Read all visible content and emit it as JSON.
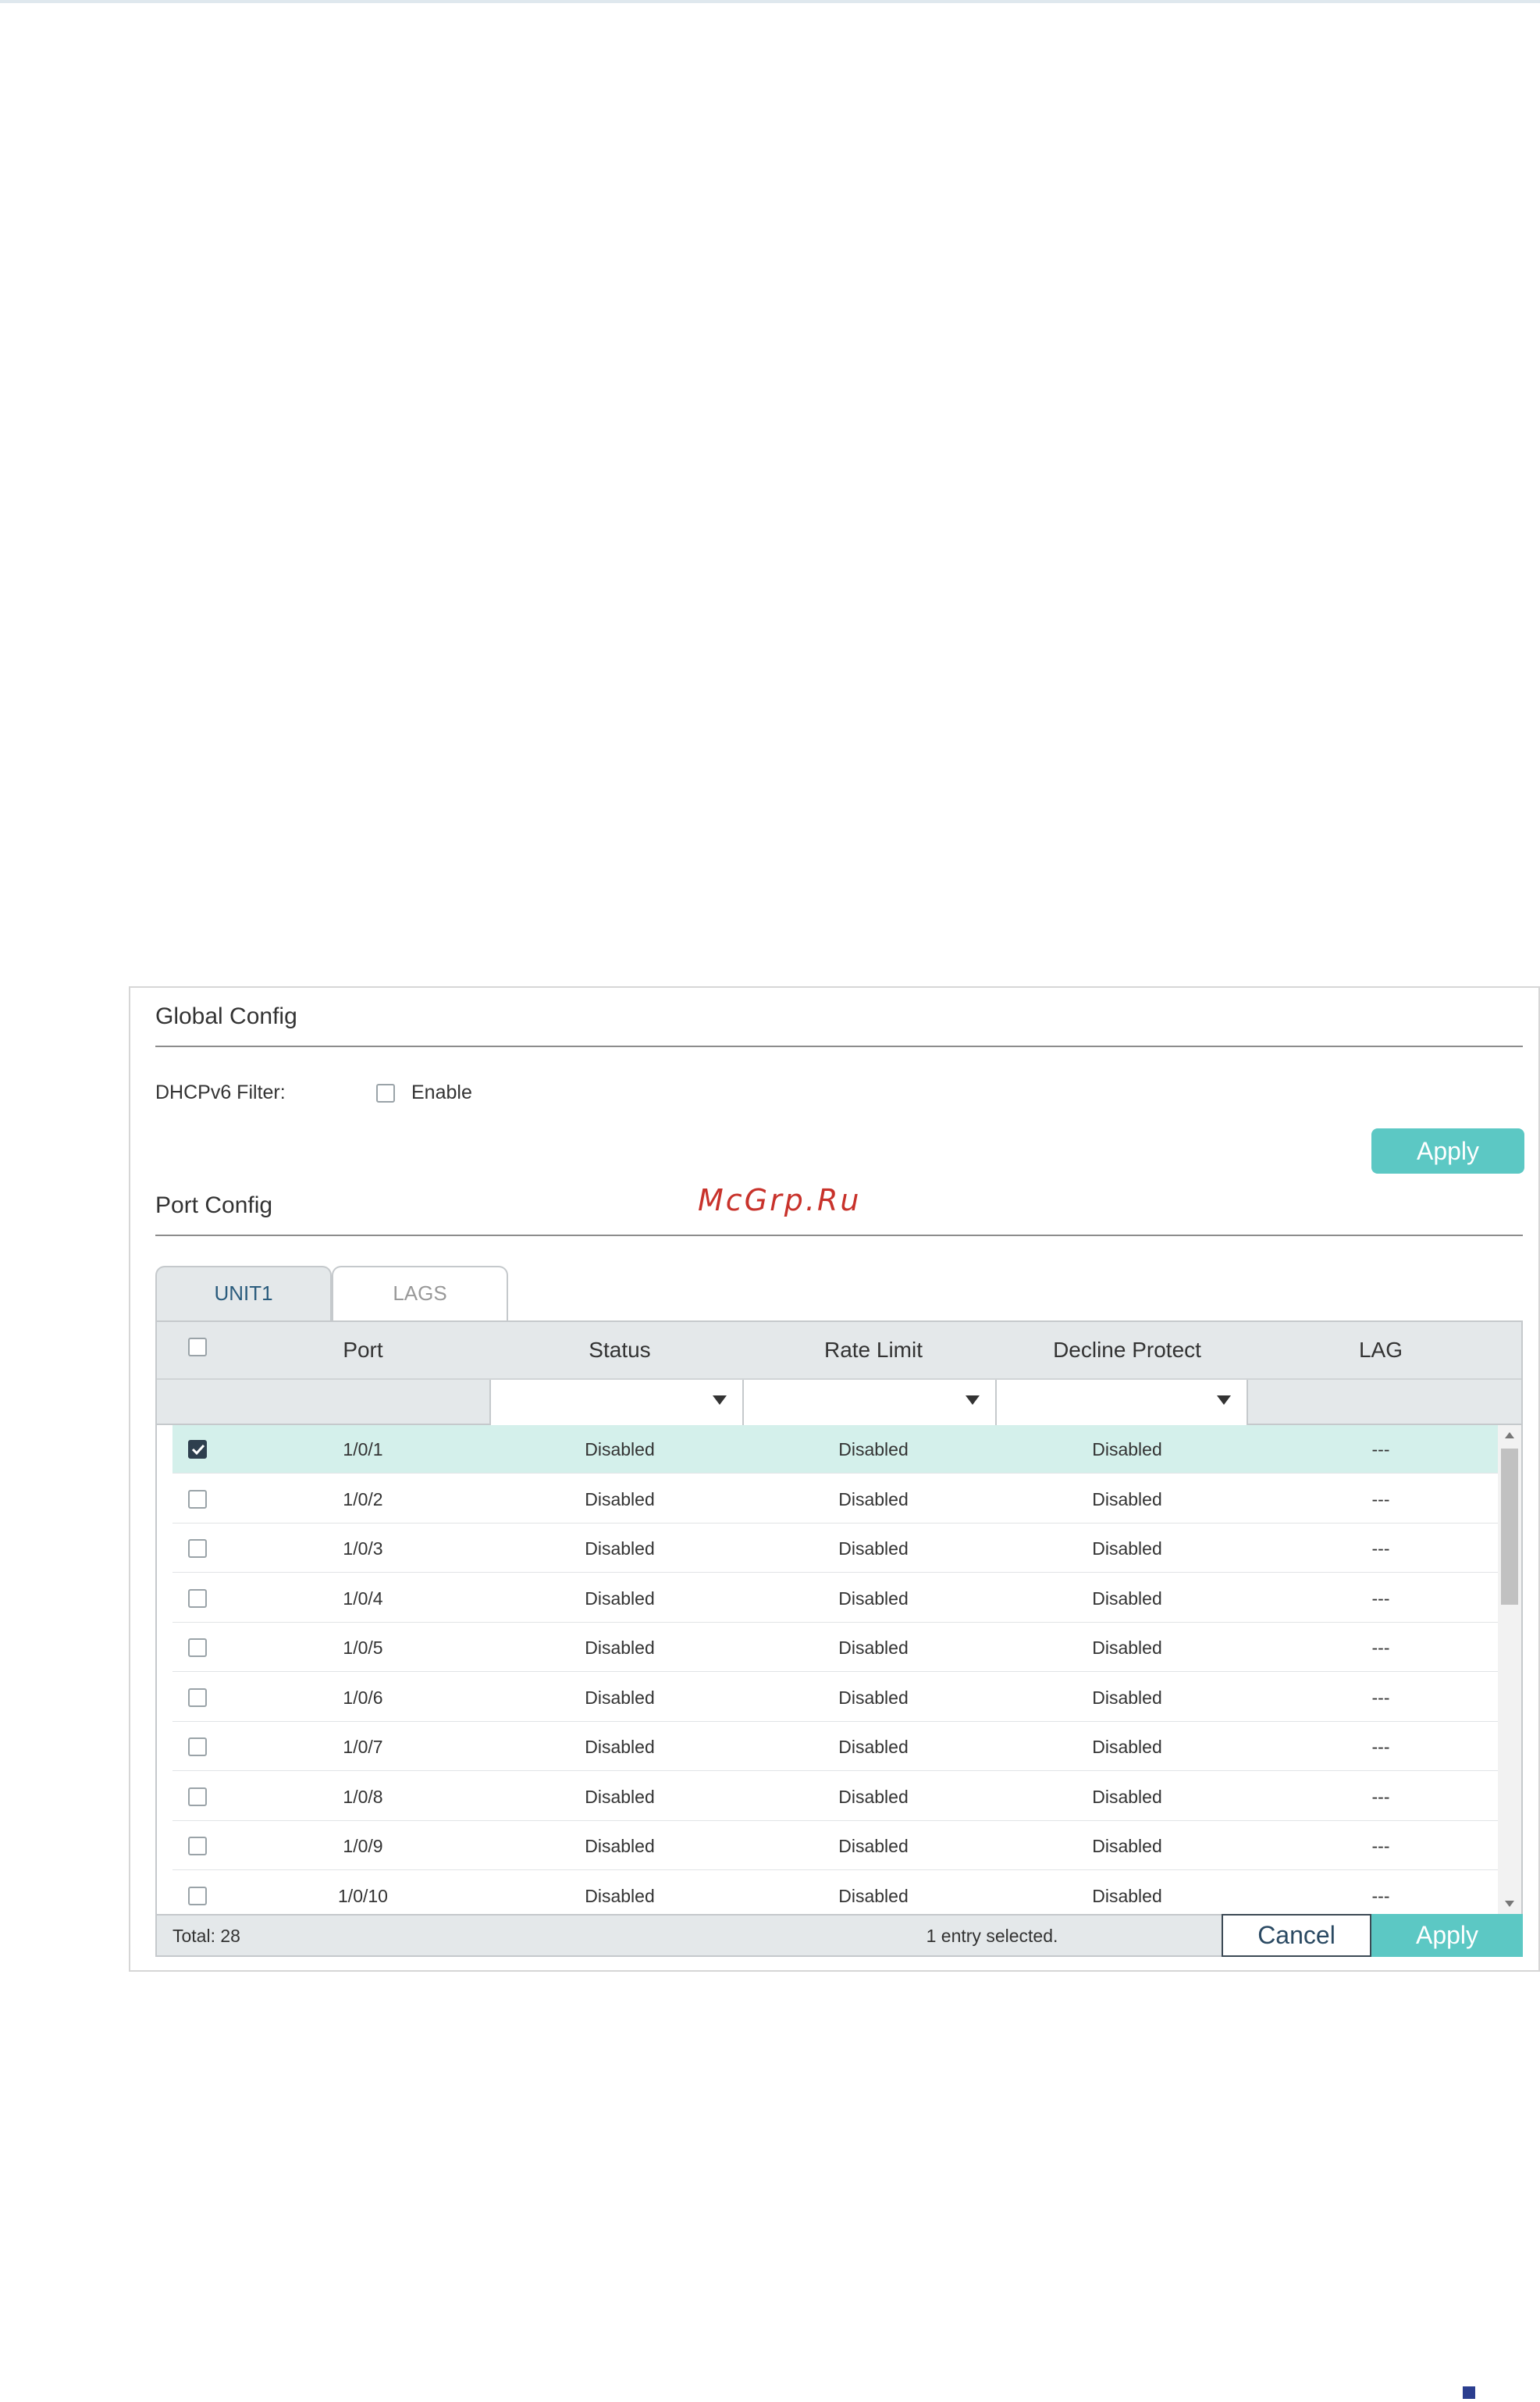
{
  "global_config": {
    "title": "Global Config",
    "dhcpv6_filter_label": "DHCPv6 Filter:",
    "enable_label": "Enable",
    "enable_checked": false,
    "apply_label": "Apply"
  },
  "watermark": "McGrp.Ru",
  "port_config": {
    "title": "Port Config",
    "tabs": [
      {
        "label": "UNIT1",
        "active": true
      },
      {
        "label": "LAGS",
        "active": false
      }
    ],
    "columns": [
      "Port",
      "Status",
      "Rate Limit",
      "Decline Protect",
      "LAG"
    ],
    "rows": [
      {
        "checked": true,
        "port": "1/0/1",
        "status": "Disabled",
        "rate_limit": "Disabled",
        "decline_protect": "Disabled",
        "lag": "---"
      },
      {
        "checked": false,
        "port": "1/0/2",
        "status": "Disabled",
        "rate_limit": "Disabled",
        "decline_protect": "Disabled",
        "lag": "---"
      },
      {
        "checked": false,
        "port": "1/0/3",
        "status": "Disabled",
        "rate_limit": "Disabled",
        "decline_protect": "Disabled",
        "lag": "---"
      },
      {
        "checked": false,
        "port": "1/0/4",
        "status": "Disabled",
        "rate_limit": "Disabled",
        "decline_protect": "Disabled",
        "lag": "---"
      },
      {
        "checked": false,
        "port": "1/0/5",
        "status": "Disabled",
        "rate_limit": "Disabled",
        "decline_protect": "Disabled",
        "lag": "---"
      },
      {
        "checked": false,
        "port": "1/0/6",
        "status": "Disabled",
        "rate_limit": "Disabled",
        "decline_protect": "Disabled",
        "lag": "---"
      },
      {
        "checked": false,
        "port": "1/0/7",
        "status": "Disabled",
        "rate_limit": "Disabled",
        "decline_protect": "Disabled",
        "lag": "---"
      },
      {
        "checked": false,
        "port": "1/0/8",
        "status": "Disabled",
        "rate_limit": "Disabled",
        "decline_protect": "Disabled",
        "lag": "---"
      },
      {
        "checked": false,
        "port": "1/0/9",
        "status": "Disabled",
        "rate_limit": "Disabled",
        "decline_protect": "Disabled",
        "lag": "---"
      },
      {
        "checked": false,
        "port": "1/0/10",
        "status": "Disabled",
        "rate_limit": "Disabled",
        "decline_protect": "Disabled",
        "lag": "---"
      }
    ],
    "total_label": "Total: 28",
    "selection_label": "1 entry selected.",
    "cancel_label": "Cancel",
    "apply_label": "Apply"
  },
  "colors": {
    "accent": "#5cc8c4",
    "selected_row": "#d4f0eb",
    "header_bg": "#e4e8ea"
  }
}
